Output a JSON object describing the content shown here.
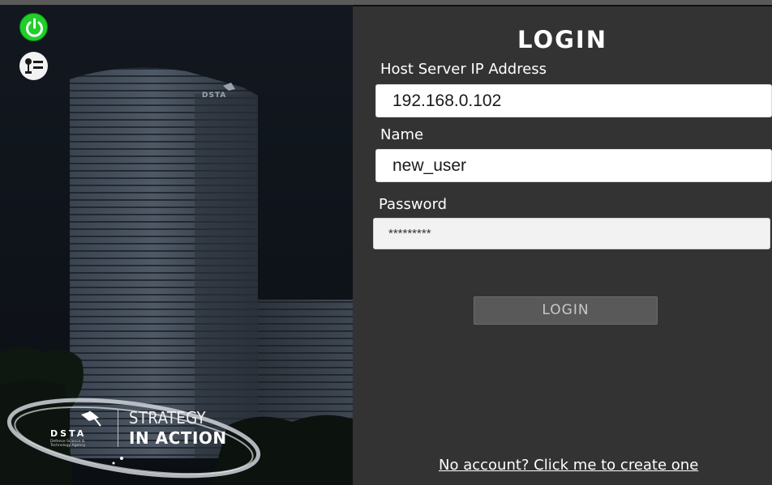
{
  "login": {
    "title": "LOGIN",
    "host_label": "Host Server IP Address",
    "host_value": "192.168.0.102",
    "name_label": "Name",
    "name_value": "new_user",
    "password_label": "Password",
    "password_value": "*********",
    "login_button": "LOGIN",
    "create_account_link": "No account? Click me to create one"
  },
  "branding": {
    "org_abbr": "DSTA",
    "org_full": "Defence Science & Technology Agency",
    "tagline_line1": "STRATEGY",
    "tagline_line2": "IN ACTION",
    "building_sign": "DSTA"
  },
  "icons": {
    "power": "power-icon",
    "settings": "settings-icon"
  },
  "colors": {
    "panel_bg": "#333333",
    "power_green": "#1fcf2a",
    "login_button_bg": "#595959"
  }
}
